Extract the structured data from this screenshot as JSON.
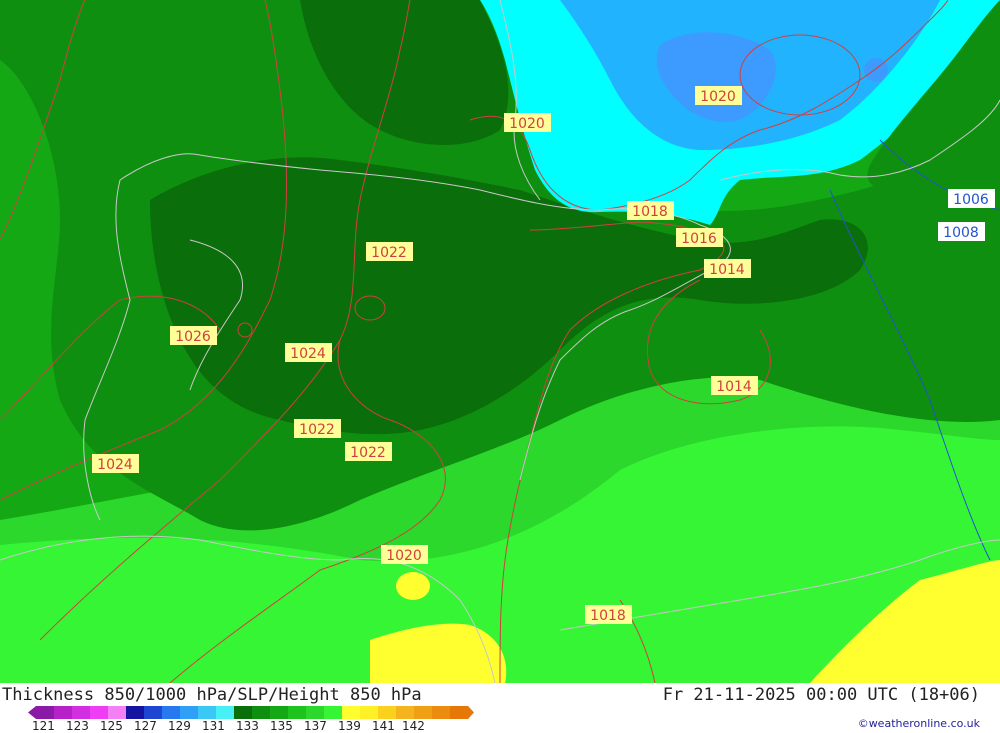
{
  "map": {
    "isobar_labels": [
      "1020",
      "1020",
      "1018",
      "1016",
      "1014",
      "1022",
      "1026",
      "1024",
      "1014",
      "1022",
      "1022",
      "1024",
      "1020",
      "1018",
      "1006",
      "1008"
    ],
    "colors": {
      "thickness_bands": [
        "#0a6e0a",
        "#0f8f0f",
        "#14a814",
        "#1ec31e",
        "#2bd82b",
        "#35f535",
        "#ffff30",
        "#00ffff",
        "#22b3ff",
        "#3d9bff"
      ],
      "isobar_line": "#d04040",
      "low_isobar_line": "#2255cc",
      "coastline": "#c8c8c8"
    }
  },
  "title": {
    "left": "Thickness 850/1000 hPa/SLP/Height 850 hPa",
    "right": "Fr 21-11-2025 00:00 UTC (18+06)"
  },
  "legend": {
    "ticks": [
      "121",
      "123",
      "125",
      "127",
      "129",
      "131",
      "133",
      "135",
      "137",
      "139",
      "141",
      "142"
    ],
    "colors": [
      "#8b1aa6",
      "#b622c8",
      "#d12fe0",
      "#ef3cf5",
      "#f580f5",
      "#1414a0",
      "#1e46d2",
      "#2878f0",
      "#2fa0f5",
      "#3cc8f5",
      "#46f0f5",
      "#0a6e0a",
      "#0f8f0f",
      "#14a814",
      "#1ec31e",
      "#2bd82b",
      "#35f535",
      "#ffff30",
      "#fff028",
      "#fad21e",
      "#f5b41e",
      "#f0a014",
      "#eb8c0f",
      "#e67808"
    ]
  },
  "credit": "©weatheronline.co.uk"
}
